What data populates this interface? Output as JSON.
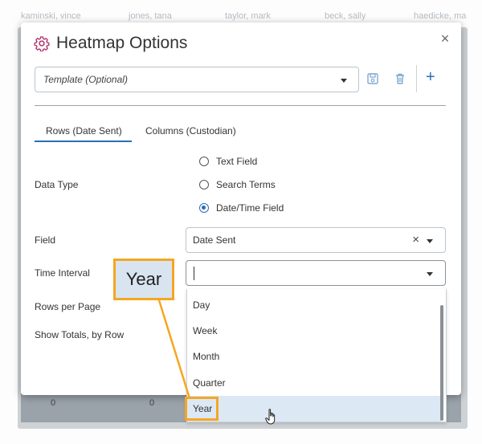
{
  "background": {
    "columns": [
      "kaminski, vince",
      "jones, tana",
      "taylor, mark",
      "beck, sally",
      "haedicke, ma"
    ],
    "zeros": [
      "0",
      "0"
    ]
  },
  "modal": {
    "title": "Heatmap Options",
    "close_label": "×",
    "template": {
      "placeholder": "Template (Optional)"
    },
    "add_label": "+",
    "tabs": [
      {
        "label": "Rows (Date Sent)",
        "active": true
      },
      {
        "label": "Columns (Custodian)",
        "active": false
      }
    ],
    "data_type": {
      "label": "Data Type",
      "options": [
        {
          "label": "Text Field",
          "checked": false
        },
        {
          "label": "Search Terms",
          "checked": false
        },
        {
          "label": "Date/Time Field",
          "checked": true
        }
      ]
    },
    "field": {
      "label": "Field",
      "value": "Date Sent",
      "clear_label": "×"
    },
    "time_interval": {
      "label": "Time Interval",
      "value": "",
      "options": [
        "Day",
        "Week",
        "Month",
        "Quarter",
        "Year"
      ],
      "hovered": "Year"
    },
    "rows_per_page": {
      "label": "Rows per Page"
    },
    "show_totals": {
      "label": "Show Totals, by Row"
    }
  },
  "callout": {
    "text": "Year"
  },
  "colors": {
    "accent": "#2a6fb5",
    "callout_border": "#f5a623",
    "gear": "#b0306a"
  }
}
